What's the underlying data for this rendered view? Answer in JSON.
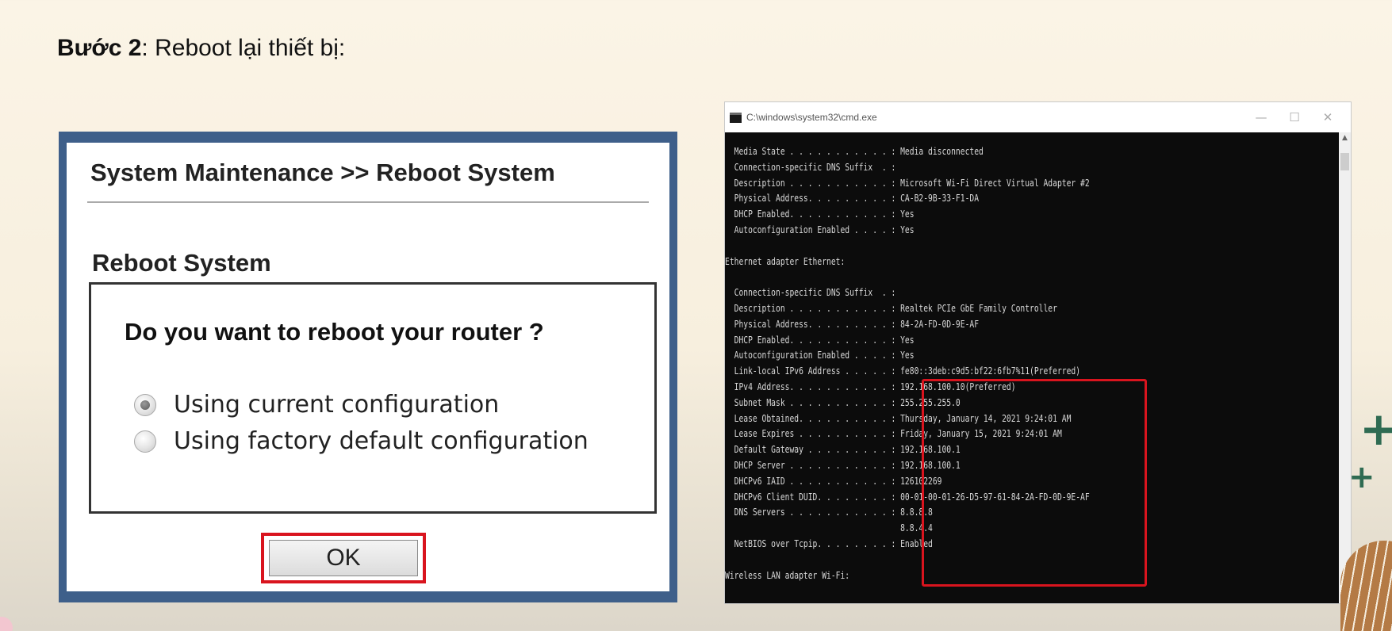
{
  "heading": {
    "step_label": "Bước 2",
    "rest": ": Reboot lại thiết bị:"
  },
  "router": {
    "breadcrumb": "System Maintenance >> Reboot System",
    "section_title": "Reboot System",
    "question": "Do you want to reboot your router ?",
    "options": [
      {
        "label": "Using current configuration",
        "selected": true
      },
      {
        "label": "Using factory default configuration",
        "selected": false
      }
    ],
    "ok_label": "OK"
  },
  "cmd": {
    "title": "C:\\windows\\system32\\cmd.exe",
    "controls": {
      "minimize": "—",
      "maximize": "☐",
      "close": "✕"
    },
    "lines": [
      "  Media State . . . . . . . . . . . : Media disconnected",
      "  Connection-specific DNS Suffix  . :",
      "  Description . . . . . . . . . . . : Microsoft Wi-Fi Direct Virtual Adapter #2",
      "  Physical Address. . . . . . . . . : CA-B2-9B-33-F1-DA",
      "  DHCP Enabled. . . . . . . . . . . : Yes",
      "  Autoconfiguration Enabled . . . . : Yes",
      "",
      "Ethernet adapter Ethernet:",
      "",
      "  Connection-specific DNS Suffix  . :",
      "  Description . . . . . . . . . . . : Realtek PCIe GbE Family Controller",
      "  Physical Address. . . . . . . . . : 84-2A-FD-0D-9E-AF",
      "  DHCP Enabled. . . . . . . . . . . : Yes",
      "  Autoconfiguration Enabled . . . . : Yes",
      "  Link-local IPv6 Address . . . . . : fe80::3deb:c9d5:bf22:6fb7%11(Preferred)",
      "  IPv4 Address. . . . . . . . . . . : 192.168.100.10(Preferred)",
      "  Subnet Mask . . . . . . . . . . . : 255.255.255.0",
      "  Lease Obtained. . . . . . . . . . : Thursday, January 14, 2021 9:24:01 AM",
      "  Lease Expires . . . . . . . . . . : Friday, January 15, 2021 9:24:01 AM",
      "  Default Gateway . . . . . . . . . : 192.168.100.1",
      "  DHCP Server . . . . . . . . . . . : 192.168.100.1",
      "  DHCPv6 IAID . . . . . . . . . . . : 126102269",
      "  DHCPv6 Client DUID. . . . . . . . : 00-01-00-01-26-D5-97-61-84-2A-FD-0D-9E-AF",
      "  DNS Servers . . . . . . . . . . . : 8.8.8.8",
      "                                      8.8.4.4",
      "  NetBIOS over Tcpip. . . . . . . . : Enabled",
      "",
      "Wireless LAN adapter Wi-Fi:"
    ]
  },
  "colors": {
    "router_frame": "#3e5f8a",
    "highlight": "#d9141e",
    "console_bg": "#0c0c0c",
    "console_text": "#d9d9d9"
  }
}
